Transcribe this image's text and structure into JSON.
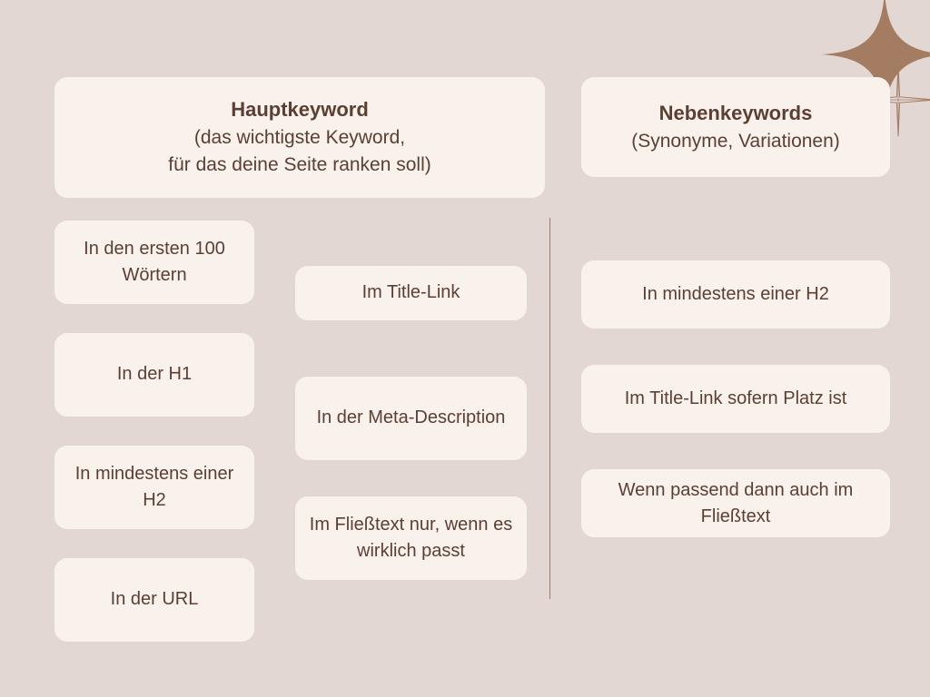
{
  "colors": {
    "background": "#e2d7d2",
    "card": "#f8f1ec",
    "text": "#5c3f33",
    "accent": "#a47c62"
  },
  "left": {
    "header": {
      "title": "Hauptkeyword",
      "subtitle1": "(das wichtigste Keyword,",
      "subtitle2": "für das deine Seite ranken soll)"
    },
    "col1": [
      "In den ersten 100 Wörtern",
      "In der H1",
      "In mindestens einer H2",
      "In der URL"
    ],
    "col2": [
      "Im Title-Link",
      "In der Meta-Description",
      "Im Fließtext nur, wenn es wirklich passt"
    ]
  },
  "right": {
    "header": {
      "title": "Nebenkeywords",
      "subtitle": "(Synonyme, Variationen)"
    },
    "items": [
      "In mindestens einer H2",
      "Im Title-Link sofern Platz ist",
      "Wenn passend dann auch im Fließtext"
    ]
  }
}
